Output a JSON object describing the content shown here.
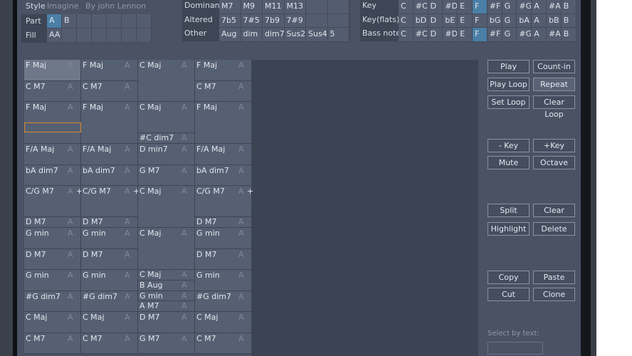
{
  "style": {
    "label": "Style",
    "name": "Imagine",
    "author": "By john Lennon"
  },
  "part": {
    "label": "Part",
    "cells": [
      "A",
      "B",
      "",
      "",
      "",
      "",
      ""
    ],
    "selected": 0
  },
  "fill": {
    "label": "Fill",
    "cells": [
      "AA",
      "",
      "",
      "",
      "",
      "",
      ""
    ]
  },
  "chord_types": [
    {
      "label": "Dominant",
      "cells": [
        "M7",
        "M9",
        "M11",
        "M13",
        "",
        ""
      ]
    },
    {
      "label": "Altered",
      "cells": [
        "7b5",
        "7#5",
        "7b9",
        "7#9",
        "",
        ""
      ]
    },
    {
      "label": "Other",
      "cells": [
        "Aug",
        "dim",
        "dim7",
        "Sus2",
        "Sus4",
        "5"
      ]
    }
  ],
  "keys": [
    {
      "label": "Key",
      "cells": [
        "C",
        "#C",
        "D",
        "#D",
        "E",
        "F",
        "#F",
        "G",
        "#G",
        "A",
        "#A",
        "B"
      ],
      "selected": 5
    },
    {
      "label": "Key(flats)",
      "cells": [
        "C",
        "bD",
        "D",
        "bE",
        "E",
        "F",
        "bG",
        "G",
        "bA",
        "A",
        "bB",
        "B"
      ],
      "selected": -1
    },
    {
      "label": "Bass note",
      "cells": [
        "C",
        "#C",
        "D",
        "#D",
        "E",
        "F",
        "#F",
        "G",
        "#G",
        "A",
        "#A",
        "B"
      ],
      "selected": 5
    }
  ],
  "columns": [
    [
      [
        "F Maj",
        2,
        "A",
        "",
        1
      ],
      [
        "C M7",
        2,
        "A"
      ],
      [
        "F Maj",
        4,
        "A"
      ],
      [
        "F/A Maj",
        2,
        "A"
      ],
      [
        "bA dim7",
        2,
        "A"
      ],
      [
        "C/G M7",
        3,
        "A",
        "+"
      ],
      [
        "D M7",
        1,
        "A"
      ],
      [
        "G min",
        2,
        "A"
      ],
      [
        "D M7",
        2,
        "A"
      ],
      [
        "G min",
        2,
        "A"
      ],
      [
        "#G dim7",
        2,
        "A"
      ],
      [
        "C Maj",
        2,
        "A"
      ],
      [
        "C M7",
        2,
        "A"
      ]
    ],
    [
      [
        "F Maj",
        2,
        "A"
      ],
      [
        "C M7",
        2,
        "A"
      ],
      [
        "F Maj",
        4,
        "A"
      ],
      [
        "F/A Maj",
        2,
        "A"
      ],
      [
        "bA dim7",
        2,
        "A"
      ],
      [
        "C/G M7",
        3,
        "A",
        "+"
      ],
      [
        "D M7",
        1,
        "A"
      ],
      [
        "G min",
        2,
        "A"
      ],
      [
        "D M7",
        2,
        "A"
      ],
      [
        "G min",
        2,
        "A"
      ],
      [
        "#G dim7",
        2,
        "A"
      ],
      [
        "C Maj",
        2,
        "A"
      ],
      [
        "C M7",
        2,
        "A"
      ]
    ],
    [
      [
        "C Maj",
        4,
        "A"
      ],
      [
        "C Maj",
        3,
        "A"
      ],
      [
        "#C dim7",
        1,
        "A"
      ],
      [
        "D min7",
        2,
        "A"
      ],
      [
        "G M7",
        2,
        "A"
      ],
      [
        "C Maj",
        4,
        "A"
      ],
      [
        "C Maj",
        4,
        "A"
      ],
      [
        "C Maj",
        1,
        "A"
      ],
      [
        "B Aug",
        1,
        "A"
      ],
      [
        "G min",
        1,
        "A"
      ],
      [
        "A M7",
        1,
        "A"
      ],
      [
        "D M7",
        2,
        "A"
      ],
      [
        "G M7",
        2,
        "A"
      ]
    ],
    [
      [
        "F Maj",
        2,
        "A"
      ],
      [
        "C M7",
        2,
        "A"
      ],
      [
        "F Maj",
        4,
        "A"
      ],
      [
        "F/A Maj",
        2,
        "A"
      ],
      [
        "bA dim7",
        2,
        "A"
      ],
      [
        "C/G M7",
        3,
        "A",
        "+"
      ],
      [
        "D M7",
        1,
        "A"
      ],
      [
        "G min",
        2,
        "A"
      ],
      [
        "D M7",
        2,
        "A"
      ],
      [
        "G min",
        2,
        "A"
      ],
      [
        "#G dim7",
        2,
        "A"
      ],
      [
        "C Maj",
        2,
        "A"
      ],
      [
        "C M7",
        2,
        "A"
      ]
    ]
  ],
  "buttons": {
    "play": "Play",
    "count_in": "Count-in",
    "play_loop": "Play Loop",
    "repeat": "Repeat",
    "set_loop": "Set Loop",
    "clear_loop": "Clear Loop",
    "minus_key": "- Key",
    "plus_key": "+Key",
    "mute": "Mute",
    "octave": "Octave",
    "split": "Split",
    "clear": "Clear",
    "highlight": "Highlight",
    "delete": "Delete",
    "copy": "Copy",
    "paste": "Paste",
    "cut": "Cut",
    "clone": "Clone"
  },
  "select_by_text": {
    "label": "Select by text:",
    "value": ""
  }
}
